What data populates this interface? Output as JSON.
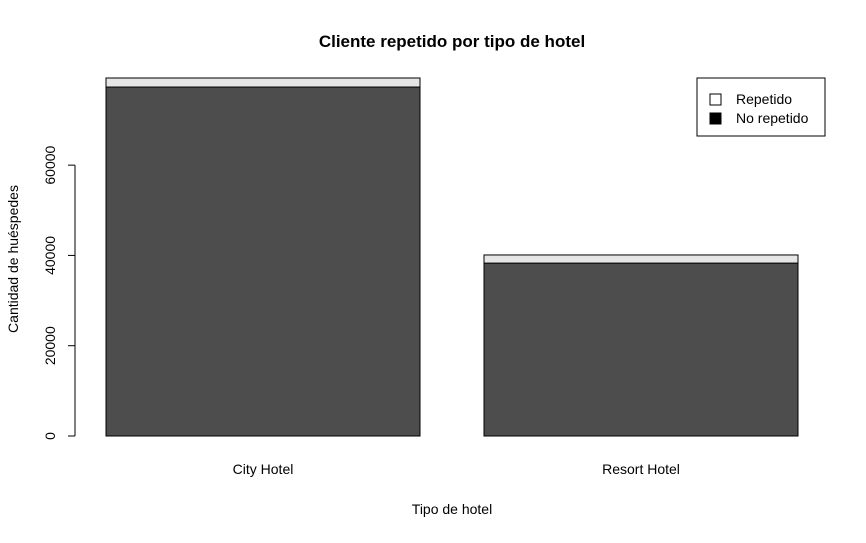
{
  "chart_data": {
    "type": "bar",
    "stacked": true,
    "title": "Cliente repetido por tipo de hotel",
    "xlabel": "Tipo de hotel",
    "ylabel": "Cantidad de huéspedes",
    "categories": [
      "City Hotel",
      "Resort Hotel"
    ],
    "series": [
      {
        "name": "No repetido",
        "values": [
          77300,
          38300
        ],
        "color": "#4d4d4d"
      },
      {
        "name": "Repetido",
        "values": [
          2000,
          1800
        ],
        "color": "#e6e6e6"
      }
    ],
    "yticks": [
      0,
      20000,
      40000,
      60000
    ],
    "ylim": [
      0,
      79300
    ],
    "legend": {
      "position": "top-right",
      "entries": [
        {
          "label": "Repetido",
          "color": "#ffffff"
        },
        {
          "label": "No repetido",
          "color": "#000000"
        }
      ]
    },
    "grid": false
  }
}
